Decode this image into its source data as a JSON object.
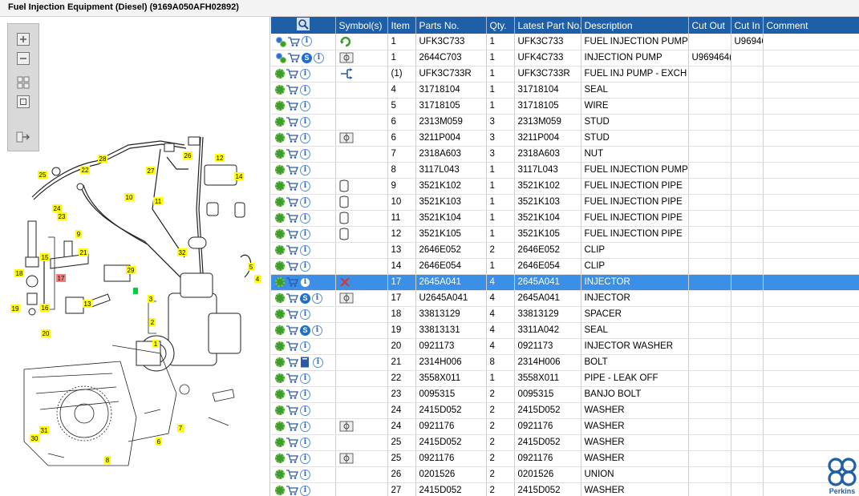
{
  "window": {
    "title": "Fuel Injection Equipment (Diesel) (9169A050AFH02892)"
  },
  "toolbox": {
    "items": [
      "zoom-in",
      "zoom-out",
      "fit-page",
      "actual-size",
      "export"
    ]
  },
  "diagram": {
    "callouts": [
      "25",
      "22",
      "28",
      "26",
      "27",
      "12",
      "14",
      "10",
      "24",
      "23",
      "9",
      "11",
      "21",
      "15",
      "18",
      "17",
      "16",
      "19",
      "20",
      "32",
      "29",
      "13",
      "5",
      "4",
      "3",
      "2",
      "1",
      "7",
      "6",
      "31",
      "30",
      "8"
    ]
  },
  "grid": {
    "columns": [
      "",
      "Symbol(s)",
      "Item",
      "Parts No.",
      "Qty.",
      "Latest Part No.",
      "Description",
      "Cut Out",
      "Cut In",
      "Comment"
    ],
    "selected_index": 15,
    "rows": [
      {
        "icons": [
          "gear-multi",
          "cart",
          "info"
        ],
        "symbol": "refresh",
        "item": "1",
        "part": "UFK3C733",
        "qty": "1",
        "latest": "UFK3C733",
        "desc": "FUEL INJECTION PUMP KIT",
        "cut_out": "",
        "cut_in": "U96946",
        "comment": ""
      },
      {
        "icons": [
          "gear-multi",
          "cart",
          "s",
          "info"
        ],
        "symbol": "book",
        "item": "1",
        "part": "2644C703",
        "qty": "1",
        "latest": "UFK4C733",
        "desc": "INJECTION PUMP",
        "cut_out": "U969464(",
        "cut_in": "",
        "comment": ""
      },
      {
        "icons": [
          "gear",
          "cart",
          "info"
        ],
        "symbol": "exchange",
        "item": "(1)",
        "part": "UFK3C733R",
        "qty": "1",
        "latest": "UFK3C733R",
        "desc": "FUEL INJ PUMP - EXCH",
        "cut_out": "",
        "cut_in": "",
        "comment": ""
      },
      {
        "icons": [
          "gear",
          "cart",
          "info"
        ],
        "symbol": "",
        "item": "4",
        "part": "31718104",
        "qty": "1",
        "latest": "31718104",
        "desc": "SEAL",
        "cut_out": "",
        "cut_in": "",
        "comment": ""
      },
      {
        "icons": [
          "gear",
          "cart",
          "info"
        ],
        "symbol": "",
        "item": "5",
        "part": "31718105",
        "qty": "1",
        "latest": "31718105",
        "desc": "WIRE",
        "cut_out": "",
        "cut_in": "",
        "comment": ""
      },
      {
        "icons": [
          "gear",
          "cart",
          "info"
        ],
        "symbol": "",
        "item": "6",
        "part": "2313M059",
        "qty": "3",
        "latest": "2313M059",
        "desc": "STUD",
        "cut_out": "",
        "cut_in": "",
        "comment": ""
      },
      {
        "icons": [
          "gear",
          "cart",
          "info"
        ],
        "symbol": "book",
        "item": "6",
        "part": "3211P004",
        "qty": "3",
        "latest": "3211P004",
        "desc": "STUD",
        "cut_out": "",
        "cut_in": "",
        "comment": ""
      },
      {
        "icons": [
          "gear",
          "cart",
          "info"
        ],
        "symbol": "",
        "item": "7",
        "part": "2318A603",
        "qty": "3",
        "latest": "2318A603",
        "desc": "NUT",
        "cut_out": "",
        "cut_in": "",
        "comment": ""
      },
      {
        "icons": [
          "gear",
          "cart",
          "info"
        ],
        "symbol": "",
        "item": "8",
        "part": "3117L043",
        "qty": "1",
        "latest": "3117L043",
        "desc": "FUEL INJECTION PUMP GEAR",
        "cut_out": "",
        "cut_in": "",
        "comment": ""
      },
      {
        "icons": [
          "gear",
          "cart",
          "info"
        ],
        "symbol": "cylinder",
        "item": "9",
        "part": "3521K102",
        "qty": "1",
        "latest": "3521K102",
        "desc": "FUEL INJECTION PIPE",
        "cut_out": "",
        "cut_in": "",
        "comment": ""
      },
      {
        "icons": [
          "gear",
          "cart",
          "info"
        ],
        "symbol": "cylinder",
        "item": "10",
        "part": "3521K103",
        "qty": "1",
        "latest": "3521K103",
        "desc": "FUEL INJECTION PIPE",
        "cut_out": "",
        "cut_in": "",
        "comment": ""
      },
      {
        "icons": [
          "gear",
          "cart",
          "info"
        ],
        "symbol": "cylinder",
        "item": "11",
        "part": "3521K104",
        "qty": "1",
        "latest": "3521K104",
        "desc": "FUEL INJECTION PIPE",
        "cut_out": "",
        "cut_in": "",
        "comment": ""
      },
      {
        "icons": [
          "gear",
          "cart",
          "info"
        ],
        "symbol": "cylinder",
        "item": "12",
        "part": "3521K105",
        "qty": "1",
        "latest": "3521K105",
        "desc": "FUEL INJECTION PIPE",
        "cut_out": "",
        "cut_in": "",
        "comment": ""
      },
      {
        "icons": [
          "gear",
          "cart",
          "info"
        ],
        "symbol": "",
        "item": "13",
        "part": "2646E052",
        "qty": "2",
        "latest": "2646E052",
        "desc": "CLIP",
        "cut_out": "",
        "cut_in": "",
        "comment": ""
      },
      {
        "icons": [
          "gear",
          "cart",
          "info"
        ],
        "symbol": "",
        "item": "14",
        "part": "2646E054",
        "qty": "1",
        "latest": "2646E054",
        "desc": "CLIP",
        "cut_out": "",
        "cut_in": "",
        "comment": ""
      },
      {
        "icons": [
          "gear",
          "cart",
          "info"
        ],
        "symbol": "cross",
        "item": "17",
        "part": "2645A041",
        "qty": "4",
        "latest": "2645A041",
        "desc": "INJECTOR",
        "cut_out": "",
        "cut_in": "",
        "comment": ""
      },
      {
        "icons": [
          "gear",
          "cart",
          "s",
          "info"
        ],
        "symbol": "book",
        "item": "17",
        "part": "U2645A041",
        "qty": "4",
        "latest": "2645A041",
        "desc": "INJECTOR",
        "cut_out": "",
        "cut_in": "",
        "comment": ""
      },
      {
        "icons": [
          "gear",
          "cart",
          "info"
        ],
        "symbol": "",
        "item": "18",
        "part": "33813129",
        "qty": "4",
        "latest": "33813129",
        "desc": "SPACER",
        "cut_out": "",
        "cut_in": "",
        "comment": ""
      },
      {
        "icons": [
          "gear",
          "cart",
          "s",
          "info"
        ],
        "symbol": "",
        "item": "19",
        "part": "33813131",
        "qty": "4",
        "latest": "3311A042",
        "desc": "SEAL",
        "cut_out": "",
        "cut_in": "",
        "comment": ""
      },
      {
        "icons": [
          "gear",
          "cart",
          "info"
        ],
        "symbol": "",
        "item": "20",
        "part": "0921173",
        "qty": "4",
        "latest": "0921173",
        "desc": "INJECTOR WASHER",
        "cut_out": "",
        "cut_in": "",
        "comment": ""
      },
      {
        "icons": [
          "gear",
          "cart",
          "doc",
          "info"
        ],
        "symbol": "",
        "item": "21",
        "part": "2314H006",
        "qty": "8",
        "latest": "2314H006",
        "desc": "BOLT",
        "cut_out": "",
        "cut_in": "",
        "comment": ""
      },
      {
        "icons": [
          "gear",
          "cart",
          "info"
        ],
        "symbol": "",
        "item": "22",
        "part": "3558X011",
        "qty": "1",
        "latest": "3558X011",
        "desc": "PIPE - LEAK OFF",
        "cut_out": "",
        "cut_in": "",
        "comment": ""
      },
      {
        "icons": [
          "gear",
          "cart",
          "info"
        ],
        "symbol": "",
        "item": "23",
        "part": "0095315",
        "qty": "2",
        "latest": "0095315",
        "desc": "BANJO BOLT",
        "cut_out": "",
        "cut_in": "",
        "comment": ""
      },
      {
        "icons": [
          "gear",
          "cart",
          "info"
        ],
        "symbol": "",
        "item": "24",
        "part": "2415D052",
        "qty": "2",
        "latest": "2415D052",
        "desc": "WASHER",
        "cut_out": "",
        "cut_in": "",
        "comment": ""
      },
      {
        "icons": [
          "gear",
          "cart",
          "info"
        ],
        "symbol": "book",
        "item": "24",
        "part": "0921176",
        "qty": "2",
        "latest": "0921176",
        "desc": "WASHER",
        "cut_out": "",
        "cut_in": "",
        "comment": ""
      },
      {
        "icons": [
          "gear",
          "cart",
          "info"
        ],
        "symbol": "",
        "item": "25",
        "part": "2415D052",
        "qty": "2",
        "latest": "2415D052",
        "desc": "WASHER",
        "cut_out": "",
        "cut_in": "",
        "comment": ""
      },
      {
        "icons": [
          "gear",
          "cart",
          "info"
        ],
        "symbol": "book",
        "item": "25",
        "part": "0921176",
        "qty": "2",
        "latest": "0921176",
        "desc": "WASHER",
        "cut_out": "",
        "cut_in": "",
        "comment": ""
      },
      {
        "icons": [
          "gear",
          "cart",
          "info"
        ],
        "symbol": "",
        "item": "26",
        "part": "0201526",
        "qty": "2",
        "latest": "0201526",
        "desc": "UNION",
        "cut_out": "",
        "cut_in": "",
        "comment": ""
      },
      {
        "icons": [
          "gear",
          "cart",
          "info"
        ],
        "symbol": "",
        "item": "27",
        "part": "2415D052",
        "qty": "2",
        "latest": "2415D052",
        "desc": "WASHER",
        "cut_out": "",
        "cut_in": "",
        "comment": ""
      }
    ]
  },
  "brand": {
    "name": "Perkins",
    "color": "#1d5fa8"
  },
  "colors": {
    "header_bg": "#1f5fa8",
    "selected_bg": "#3b8fe6",
    "callout_bg": "#ffff00",
    "callout_active": "#f08080"
  }
}
